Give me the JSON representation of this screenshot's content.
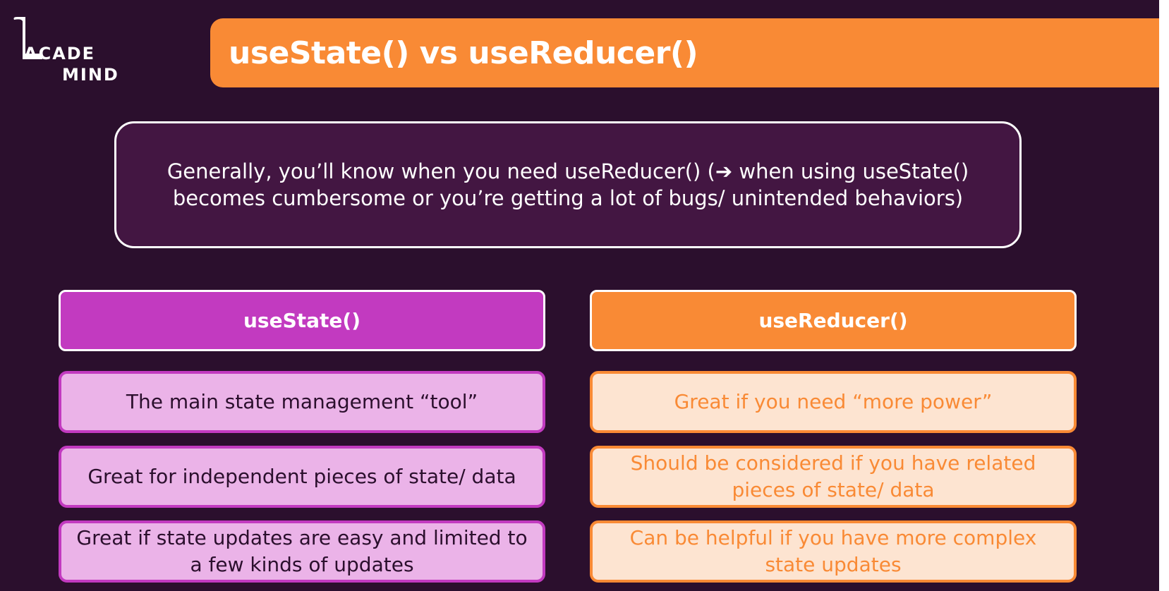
{
  "logo": {
    "line1": "ACADE",
    "line2": "MIND"
  },
  "title": "useState() vs useReducer()",
  "note": {
    "line1": "Generally, you’ll know when you need useReducer() (➔ when using useState()",
    "line2": "becomes cumbersome or you’re getting a lot of bugs/ unintended behaviors)"
  },
  "left_column": {
    "header": "useState()",
    "items": [
      "The main state management “tool”",
      "Great for independent pieces of state/ data",
      "Great if state updates are easy and limited to a few kinds of updates"
    ]
  },
  "right_column": {
    "header": "useReducer()",
    "items": [
      "Great if you need “more power”",
      "Should be considered if you have related pieces of state/ data",
      "Can be helpful if you have more complex state updates"
    ]
  },
  "colors": {
    "background": "#2b0f2d",
    "orange": "#f98a35",
    "purple": "#c23ac0",
    "light_purple": "#ebb3e8",
    "light_orange": "#fde4d1"
  }
}
